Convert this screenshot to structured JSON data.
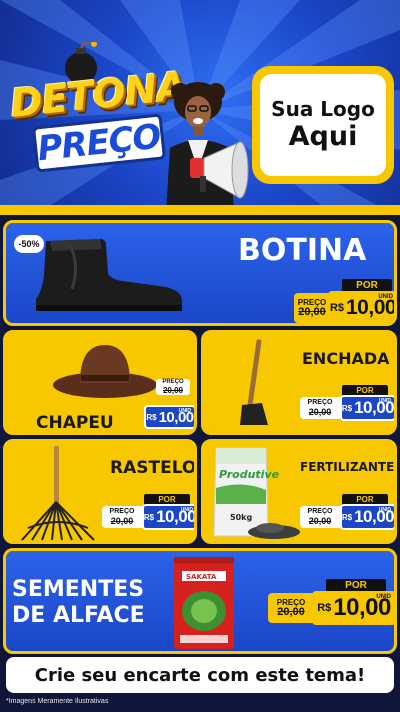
{
  "header": {
    "logo_line1": "DETONA",
    "logo_line2": "PREÇO",
    "sua_logo_line1": "Sua Logo",
    "sua_logo_line2": "Aqui"
  },
  "products": [
    {
      "name": "BOTINA",
      "discount_badge": "-50%",
      "price": {
        "por": "POR",
        "preco": "PREÇO",
        "old": "20,00",
        "currency": "R$",
        "value": "10,00",
        "unit": "UNID"
      }
    },
    {
      "name": "CHAPEU",
      "price": {
        "por": "POR",
        "preco": "PREÇO",
        "old": "20,00",
        "currency": "R$",
        "value": "10,00",
        "unit": "UNID"
      }
    },
    {
      "name": "ENCHADA",
      "price": {
        "por": "POR",
        "preco": "PREÇO",
        "old": "20,00",
        "currency": "R$",
        "value": "10,00",
        "unit": "UNID"
      }
    },
    {
      "name": "RASTELO",
      "price": {
        "por": "POR",
        "preco": "PREÇO",
        "old": "20,00",
        "currency": "R$",
        "value": "10,00",
        "unit": "UNID"
      }
    },
    {
      "name": "FERTILIZANTES",
      "bag_label": "Produtive",
      "bag_weight": "50kg",
      "price": {
        "por": "POR",
        "preco": "PREÇO",
        "old": "20,00",
        "currency": "R$",
        "value": "10,00",
        "unit": "UNID"
      }
    },
    {
      "name_line1": "SEMENTES",
      "name_line2": "DE ALFACE",
      "pack_brand": "SAKATA",
      "price": {
        "por": "POR",
        "preco": "PREÇO",
        "old": "20,00",
        "currency": "R$",
        "value": "10,00",
        "unit": "UNID"
      }
    }
  ],
  "footer": {
    "cta": "Crie seu encarte com este tema!",
    "disclaimer": "*Imagens Meramente Ilustrativas"
  },
  "colors": {
    "brand_blue": "#1b46c8",
    "brand_yellow": "#f7c700",
    "background": "#10163a"
  },
  "icons": [
    "bomb-icon",
    "megaphone-icon"
  ]
}
